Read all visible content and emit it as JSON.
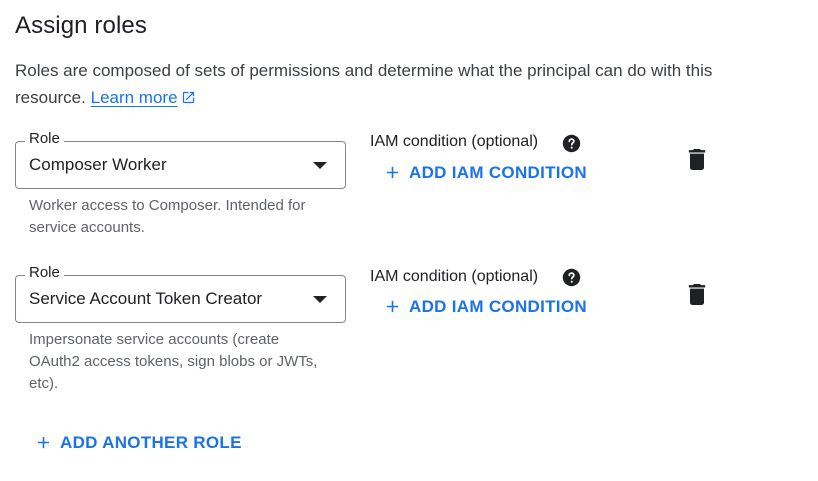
{
  "header": {
    "title": "Assign roles",
    "description": "Roles are composed of sets of permissions and determine what the principal can do with this resource.",
    "learn_more": "Learn more"
  },
  "roles": [
    {
      "field_label": "Role",
      "value": "Composer Worker",
      "hint": "Worker access to Composer. Intended for service accounts.",
      "iam_label": "IAM condition (optional)",
      "add_condition": "ADD IAM CONDITION"
    },
    {
      "field_label": "Role",
      "value": "Service Account Token Creator",
      "hint": "Impersonate service accounts (create OAuth2 access tokens, sign blobs or JWTs, etc).",
      "iam_label": "IAM condition (optional)",
      "add_condition": "ADD IAM CONDITION"
    }
  ],
  "add_another_role": "ADD ANOTHER ROLE",
  "colors": {
    "accent": "#1a73e8",
    "text": "#202124",
    "muted": "#5f6368",
    "border": "#80868b"
  },
  "icons": {
    "external_link": "open-in-new-icon",
    "help": "help-circle-icon",
    "delete": "trash-icon",
    "add": "plus-icon",
    "dropdown": "caret-down-icon"
  }
}
